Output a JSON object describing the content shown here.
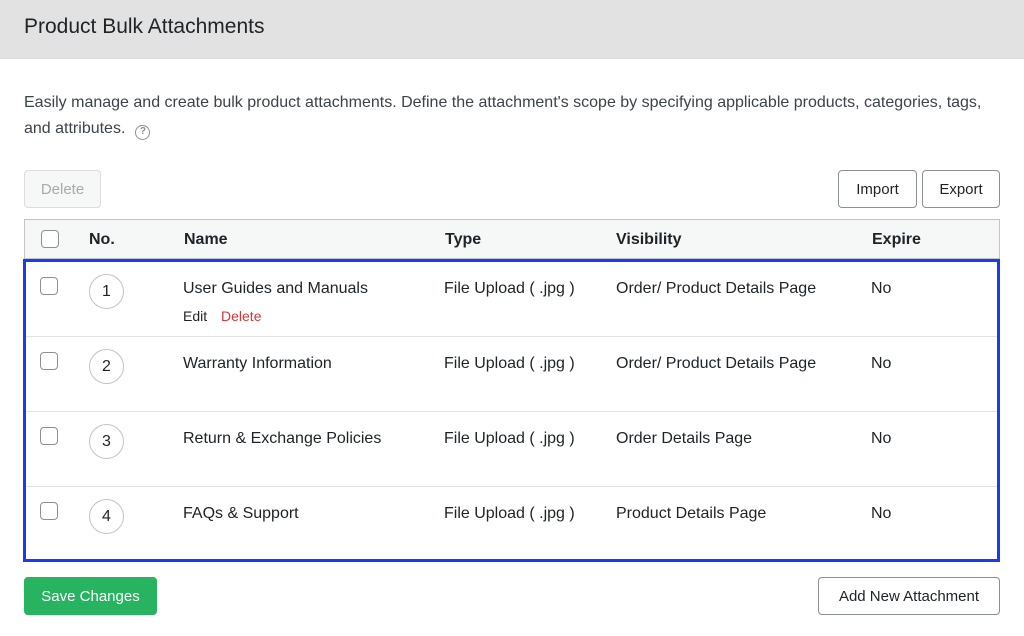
{
  "header": {
    "title": "Product Bulk Attachments"
  },
  "description": {
    "text": "Easily manage and create bulk product attachments. Define the attachment's scope by specifying applicable products, categories, tags, and attributes.",
    "help_icon": "question-circle-icon"
  },
  "toolbar": {
    "delete_label": "Delete",
    "import_label": "Import",
    "export_label": "Export"
  },
  "table": {
    "columns": {
      "no": "No.",
      "name": "Name",
      "type": "Type",
      "visibility": "Visibility",
      "expire": "Expire"
    },
    "rows": [
      {
        "no": "1",
        "name": "User Guides and Manuals",
        "type": "File Upload ( .jpg )",
        "visibility": "Order/ Product Details Page",
        "expire": "No",
        "edit": "Edit",
        "delete": "Delete"
      },
      {
        "no": "2",
        "name": "Warranty Information",
        "type": "File Upload ( .jpg )",
        "visibility": "Order/ Product Details Page",
        "expire": "No"
      },
      {
        "no": "3",
        "name": "Return & Exchange Policies",
        "type": "File Upload ( .jpg )",
        "visibility": "Order Details Page",
        "expire": "No"
      },
      {
        "no": "4",
        "name": "FAQs & Support",
        "type": "File Upload ( .jpg )",
        "visibility": "Product Details Page",
        "expire": "No"
      }
    ]
  },
  "footer": {
    "save_label": "Save Changes",
    "add_label": "Add New Attachment"
  },
  "colors": {
    "accent_green": "#27b35f",
    "highlight_blue": "#1a3cf0",
    "delete_red": "#d63638"
  }
}
